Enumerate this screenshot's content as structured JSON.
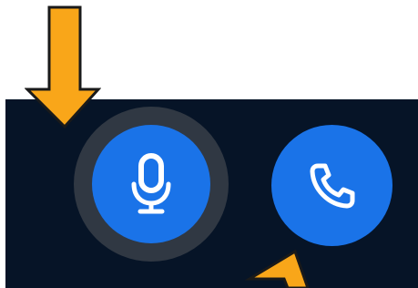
{
  "colors": {
    "background": "#ffffff",
    "call_bar": "#061427",
    "focus_ring": "#303843",
    "button_accent": "#1A73E8",
    "icon": "#ffffff",
    "arrow_fill": "#F9A619",
    "arrow_outline": "#1A1A1A"
  },
  "controls": {
    "mic": {
      "icon": "microphone-icon",
      "state": "focused"
    },
    "call": {
      "icon": "phone-icon"
    }
  },
  "annotations": {
    "top_arrow": {
      "direction": "down"
    },
    "bottom_arrow": {
      "direction": "up-left"
    }
  }
}
